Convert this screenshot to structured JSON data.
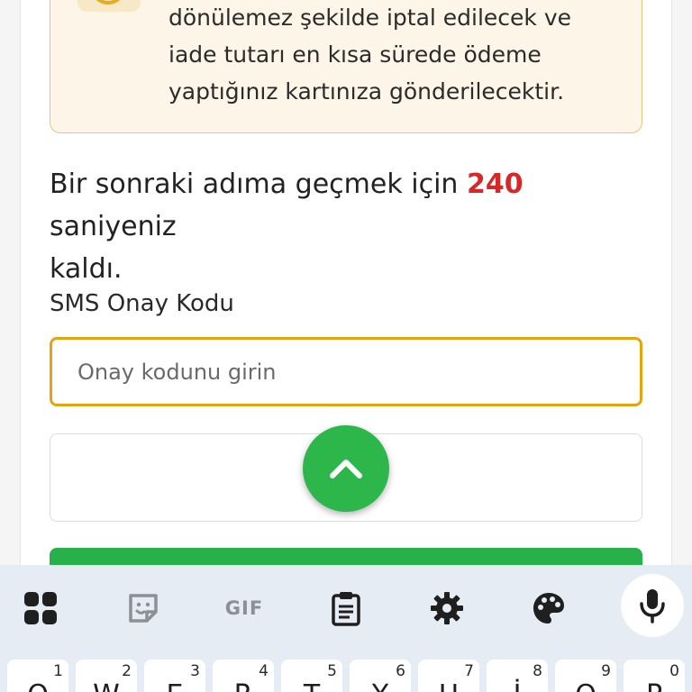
{
  "notice": {
    "lines": [
      "dönülemez şekilde iptal edilecek ve",
      "iade tutarı en kısa sürede ödeme",
      "yaptığınız kartınıza gönderilecektir."
    ]
  },
  "countdown": {
    "prefix": "Bir sonraki adıma geçmek için ",
    "seconds": "240",
    "suffix": " saniyeniz",
    "line2": "kaldı."
  },
  "sms": {
    "label": "SMS Onay Kodu",
    "placeholder": "Onay kodunu girin",
    "value": ""
  },
  "fab": {
    "icon": "chevron-up-icon",
    "color": "#2db74a"
  },
  "colors": {
    "accent": "#e5a40f",
    "countdown_number": "#d62828",
    "primary_button": "#28b04a"
  },
  "keyboard": {
    "toolbar": [
      {
        "icon": "apps-grid-icon"
      },
      {
        "icon": "sticker-icon"
      },
      {
        "icon": "gif-icon",
        "label": "GIF"
      },
      {
        "icon": "clipboard-icon"
      },
      {
        "icon": "settings-gear-icon"
      },
      {
        "icon": "palette-icon"
      },
      {
        "icon": "microphone-icon"
      }
    ],
    "keys": [
      {
        "main": "Q",
        "hint": "1"
      },
      {
        "main": "W",
        "hint": "2"
      },
      {
        "main": "E",
        "hint": "3"
      },
      {
        "main": "R",
        "hint": "4"
      },
      {
        "main": "T",
        "hint": "5"
      },
      {
        "main": "Y",
        "hint": "6"
      },
      {
        "main": "U",
        "hint": "7"
      },
      {
        "main": "İ",
        "hint": "8"
      },
      {
        "main": "O",
        "hint": "9"
      },
      {
        "main": "P",
        "hint": "0"
      }
    ]
  }
}
